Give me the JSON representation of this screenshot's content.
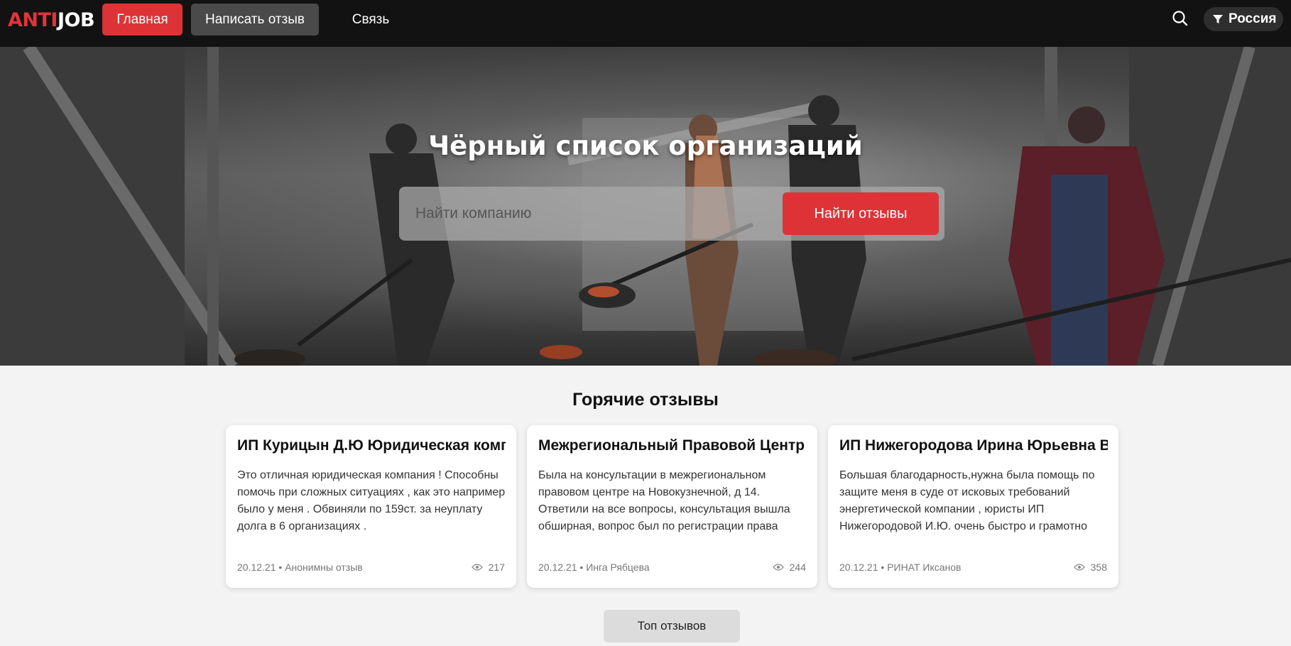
{
  "header": {
    "logo_a": "ANTI",
    "logo_b": "JOB",
    "nav": {
      "home": "Главная",
      "write": "Написать отзыв",
      "contact": "Связь"
    },
    "region": "Россия"
  },
  "hero": {
    "title": "Чёрный список организаций",
    "search_placeholder": "Найти компанию",
    "search_button": "Найти отзывы"
  },
  "hot": {
    "title": "Горячие отзывы",
    "cards": [
      {
        "title": "ИП Курицын Д.Ю Юридическая компания",
        "text": "Это отличная юридическая компания ! Способны помочь при сложных ситуациях , как это например было у меня . Обвиняли по 159ст. за неуплату долга в 6 организациях .",
        "date": "20.12.21",
        "author": "Анонимны отзыв",
        "views": "217"
      },
      {
        "title": "Межрегиональный Правовой Центр Кирова",
        "text": "Была на консультации в межрегиональном правовом центре на Новокузнечной, д 14. Ответили на все вопросы, консультация вышла обширная, вопрос был по регистрации права собственности на участок. Спасибо, планирую и в дальнейшем обращаться",
        "date": "20.12.21",
        "author": "Инга Рябцева",
        "views": "244"
      },
      {
        "title": "ИП Нижегородова Ирина Юрьевна Владимирская",
        "text": "Большая благодарность,нужна была помощь по защите меня в суде от исковых требований энергетической компании , юристы ИП Нижегородовой И.Ю. очень быстро и грамотно отреагировали, очень доволен работой. Если",
        "date": "20.12.21",
        "author": "РИНАТ Иксанов",
        "views": "358"
      }
    ],
    "top_button": "Топ отзывов"
  },
  "colors": {
    "accent": "#dd3337",
    "header_bg": "#121212",
    "page_bg": "#f3f3f3"
  },
  "icons": {
    "search": "search-icon",
    "region": "filter-icon",
    "views": "eye-icon"
  }
}
